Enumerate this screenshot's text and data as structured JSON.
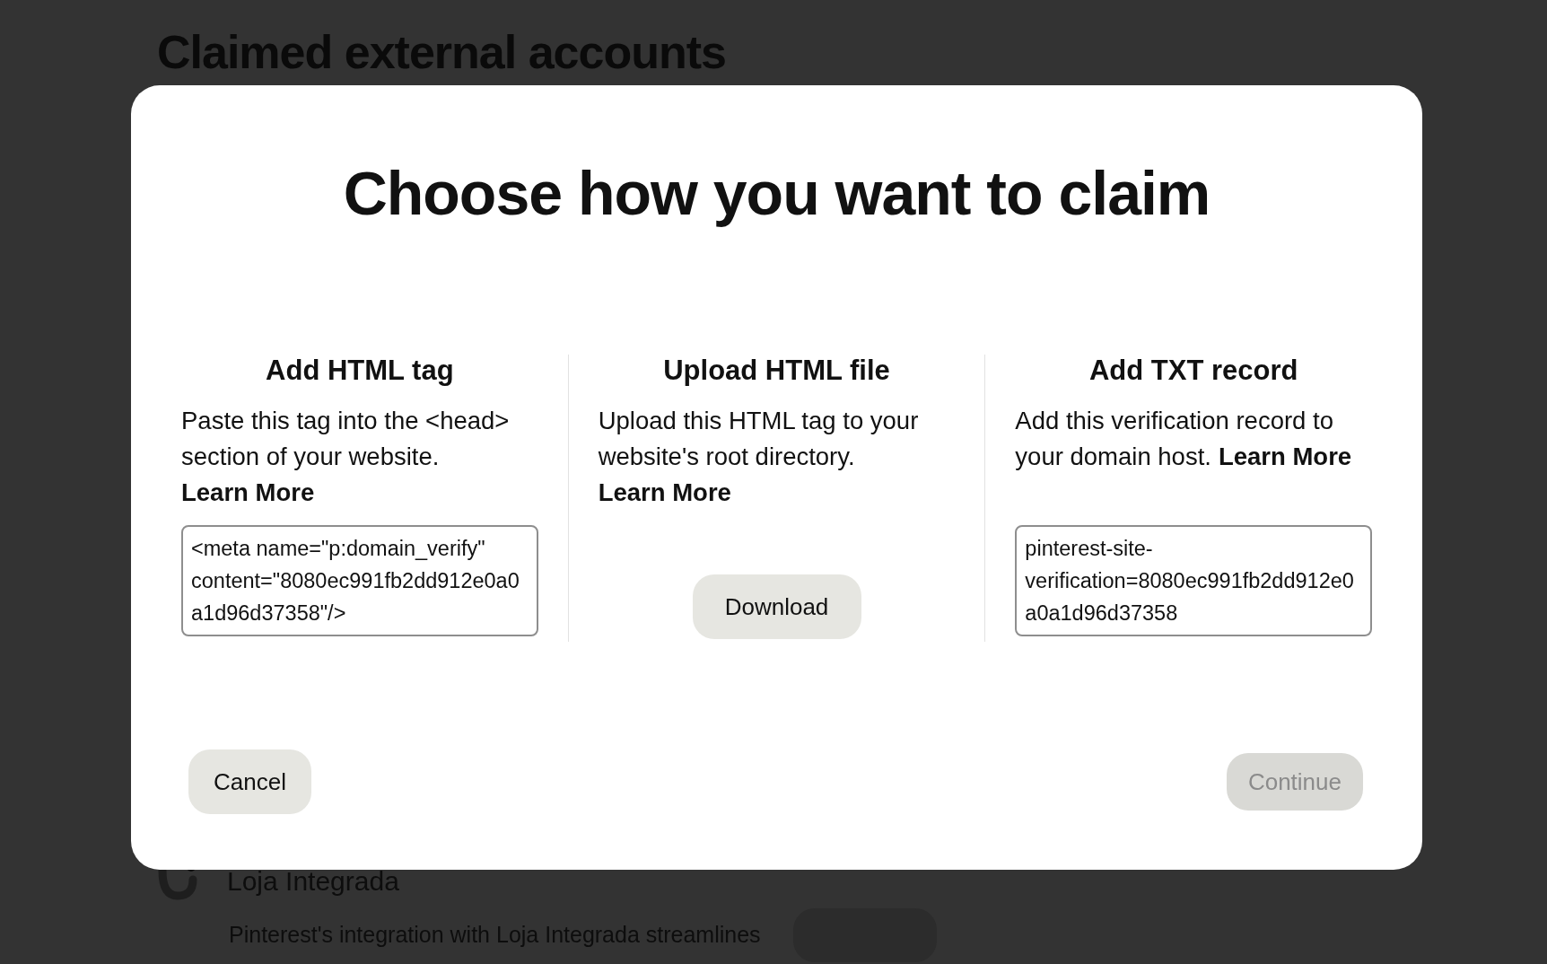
{
  "page": {
    "heading": "Claimed external accounts",
    "integration": {
      "name": "Loja Integrada",
      "description": "Pinterest's integration with Loja Integrada streamlines"
    }
  },
  "dialog": {
    "title": "Choose how you want to claim",
    "options": [
      {
        "kind": "code",
        "heading": "Add HTML tag",
        "description": "Paste this tag into the <head> section of your website.",
        "link": "Learn More",
        "link_inline": false,
        "value": "<meta name=\"p:domain_verify\" content=\"8080ec991fb2dd912e0a0a1d96d37358\"/>"
      },
      {
        "kind": "button",
        "heading": "Upload HTML file",
        "description": "Upload this HTML tag to your website's root directory.",
        "link": "Learn More",
        "link_inline": false,
        "button": "Download"
      },
      {
        "kind": "code",
        "heading": "Add TXT record",
        "description": "Add this verification record to your domain host.",
        "link": "Learn More",
        "link_inline": true,
        "value": "pinterest-site-verification=8080ec991fb2dd912e0a0a1d96d37358"
      }
    ],
    "buttons": [
      {
        "label": "Cancel",
        "disabled": false
      },
      {
        "label": "Continue",
        "disabled": true
      }
    ]
  }
}
